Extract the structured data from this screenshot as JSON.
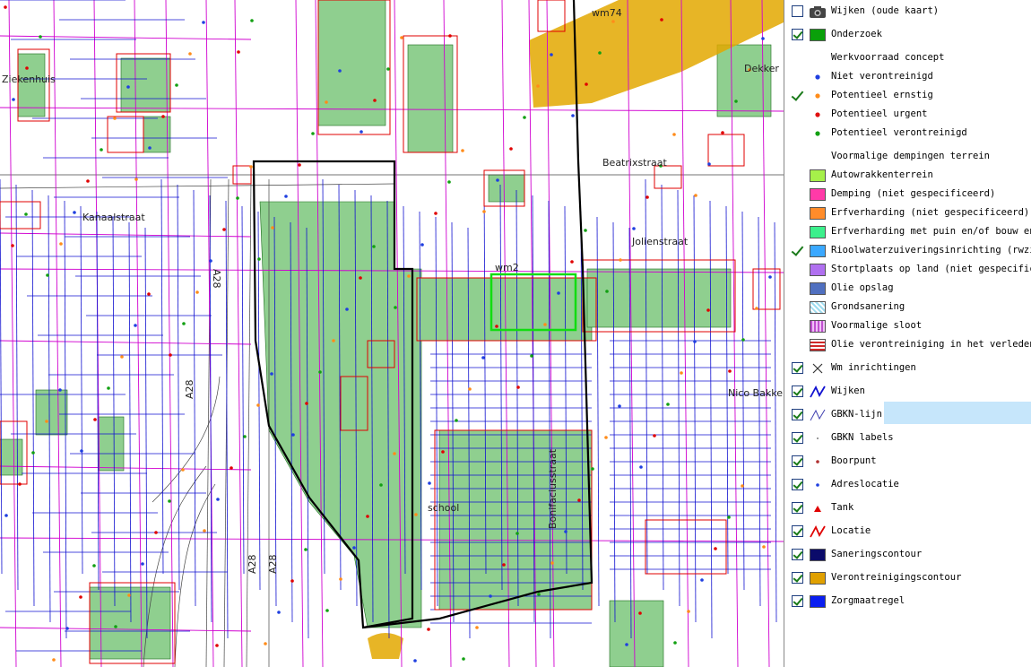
{
  "map": {
    "street_labels": [
      "Ziekenhuis",
      "Kanaalstraat",
      "Beatrixstraat",
      "Jolienstraat",
      "Bonifaciusstraat",
      "school",
      "A28",
      "A28",
      "A28",
      "A28",
      "wm74",
      "wm2",
      "Dekker",
      "Nico Bakker"
    ],
    "colors": {
      "research": "#8fcf8f",
      "locatie": "#e00000",
      "wijken": "#1010d0",
      "gbkn": "#d000d0",
      "contour": "#e3a800",
      "sanering": "#000000",
      "rwzi": "#11dd11"
    }
  },
  "legend": {
    "items": [
      {
        "kind": "layer",
        "checked": false,
        "icon": "camera-icon",
        "label": "Wijken (oude kaart)"
      },
      {
        "kind": "layer",
        "checked": true,
        "swatch": "#0aa00a",
        "label": "Onderzoek"
      },
      {
        "kind": "header",
        "label": "Werkvoorraad concept"
      },
      {
        "kind": "point",
        "color": "#1f3fe0",
        "label": "Niet verontreinigd"
      },
      {
        "kind": "point",
        "color": "#ff8c1a",
        "label": "Potentieel ernstig",
        "checked": true
      },
      {
        "kind": "point",
        "color": "#e01010",
        "label": "Potentieel urgent"
      },
      {
        "kind": "point",
        "color": "#12a012",
        "label": "Potentieel verontreinigd"
      },
      {
        "kind": "header",
        "label": "Voormalige dempingen terrein"
      },
      {
        "kind": "fill",
        "swatch": "#a6f04a",
        "label": "Autowrakkenterrein"
      },
      {
        "kind": "fill",
        "swatch": "#ff3aa8",
        "label": "Demping (niet gespecificeerd)"
      },
      {
        "kind": "fill",
        "swatch": "#ff8c2a",
        "label": "Erfverharding (niet gespecificeerd)"
      },
      {
        "kind": "fill",
        "swatch": "#3cf08c",
        "label": "Erfverharding met puin en/of bouw en"
      },
      {
        "kind": "fill",
        "swatch": "#3aa8ff",
        "label": "Rioolwaterzuiveringsinrichting (rwzi)",
        "checked": true
      },
      {
        "kind": "fill",
        "swatch": "#b070f0",
        "label": "Stortplaats op land (niet gespecifice"
      },
      {
        "kind": "fill",
        "swatch": "#5070c0",
        "label": "Olie opslag"
      },
      {
        "kind": "fill",
        "swatch": "#9edcef",
        "label": "Grondsanering"
      },
      {
        "kind": "fill",
        "swatch": "#c050d0",
        "label": "Voormalige sloot"
      },
      {
        "kind": "fill",
        "swatch": "#d02828",
        "label": "Olie verontreiniging in het verleden"
      },
      {
        "kind": "layer",
        "checked": true,
        "icon": "cross-icon",
        "label": "Wm inrichtingen"
      },
      {
        "kind": "layer",
        "checked": true,
        "icon": "wijken-line-icon",
        "label": "Wijken"
      },
      {
        "kind": "layer",
        "checked": true,
        "icon": "gbkn-line-icon",
        "label": "GBKN-lijn",
        "selected": true
      },
      {
        "kind": "layer",
        "checked": true,
        "icon": "dot-icon",
        "label": "GBKN labels"
      },
      {
        "kind": "layer",
        "checked": true,
        "icon": "boorpunt-icon",
        "label": "Boorpunt"
      },
      {
        "kind": "layer",
        "checked": true,
        "icon": "adres-icon",
        "label": "Adreslocatie"
      },
      {
        "kind": "layer",
        "checked": true,
        "icon": "tank-icon",
        "label": "Tank"
      },
      {
        "kind": "layer",
        "checked": true,
        "icon": "locatie-line-icon",
        "label": "Locatie"
      },
      {
        "kind": "layer",
        "checked": true,
        "swatch": "#0b0b6a",
        "label": "Saneringscontour"
      },
      {
        "kind": "layer",
        "checked": true,
        "swatch": "#e0a000",
        "label": "Verontreinigingscontour"
      },
      {
        "kind": "layer",
        "checked": true,
        "swatch": "#0a1ef0",
        "label": "Zorgmaatregel"
      }
    ]
  }
}
